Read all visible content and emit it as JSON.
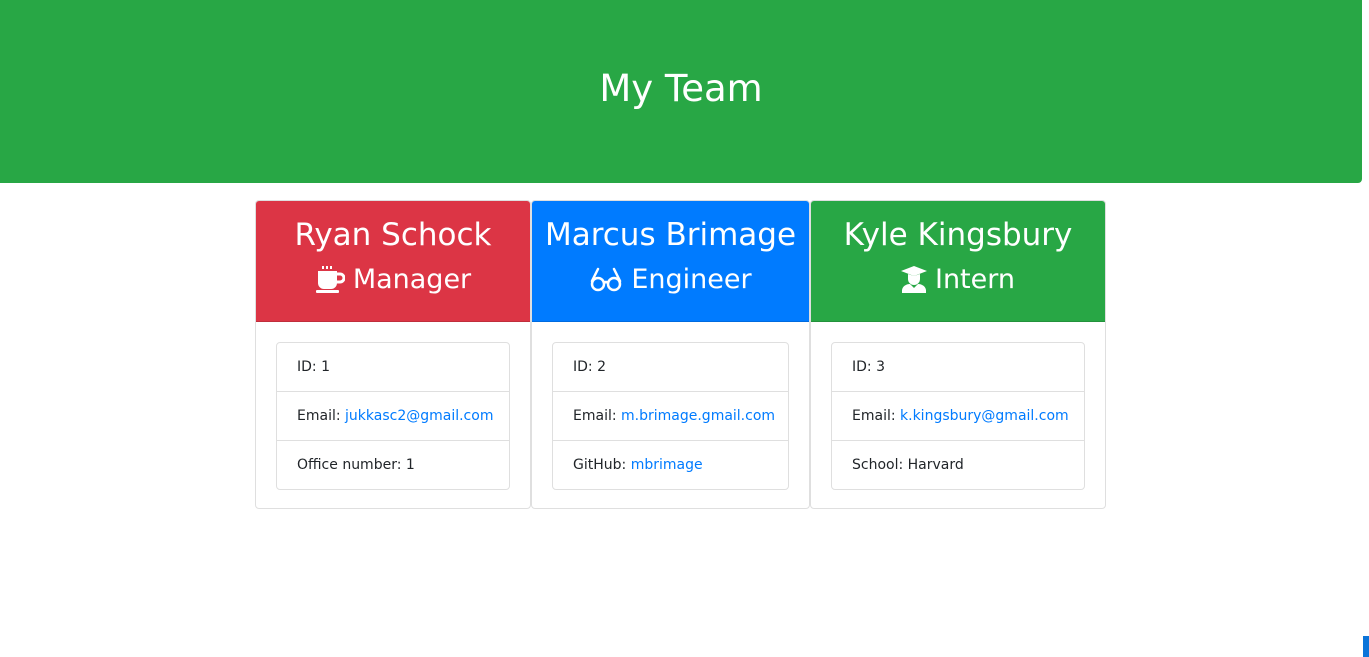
{
  "page": {
    "title": "My Team"
  },
  "team": [
    {
      "name": "Ryan Schock",
      "role": "Manager",
      "icon": "coffee-icon",
      "color": "#dc3545",
      "id_label": "ID: 1",
      "email_label": "Email: ",
      "email": "jukkasc2@gmail.com",
      "extra_label": "Office number: 1",
      "extra_link": ""
    },
    {
      "name": "Marcus Brimage",
      "role": "Engineer",
      "icon": "glasses-icon",
      "color": "#007bff",
      "id_label": "ID: 2",
      "email_label": "Email: ",
      "email": "m.brimage.gmail.com",
      "extra_label": "GitHub: ",
      "extra_link": "mbrimage"
    },
    {
      "name": "Kyle Kingsbury",
      "role": "Intern",
      "icon": "graduate-icon",
      "color": "#28a745",
      "id_label": "ID: 3",
      "email_label": "Email: ",
      "email": "k.kingsbury@gmail.com",
      "extra_label": "School: Harvard",
      "extra_link": ""
    }
  ],
  "colors": {
    "header": "#28a745",
    "link": "#007bff"
  }
}
